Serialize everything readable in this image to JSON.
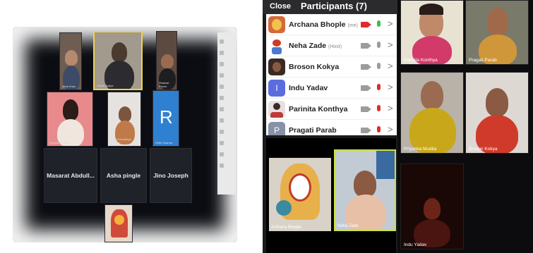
{
  "left_screen": {
    "tiles": [
      {
        "name": "Ishat Khan"
      },
      {
        "name": "Vishal Mojiya"
      },
      {
        "name": "Shaiwal Pravin"
      },
      {
        "name": "Suchita Natanai"
      },
      {
        "name": "Jyoti Holuradaya Chavan"
      },
      {
        "name": "Ridhi Sharma"
      },
      {
        "name": "Masarat Abdull..."
      },
      {
        "name": "Asha pingle"
      },
      {
        "name": "Jino Joseph"
      }
    ],
    "letter_tile": "R"
  },
  "participants_panel": {
    "close_label": "Close",
    "title": "Participants (7)",
    "rows": [
      {
        "name": "Archana Bhople",
        "tag": "(me)",
        "cam_color": "#e02b2b",
        "mic_color": "#3bbf4d",
        "chevron": ">"
      },
      {
        "name": "Neha Zade",
        "tag": "(Host)",
        "cam_color": "#9c9c9c",
        "mic_color": "#9c9c9c",
        "chevron": ">"
      },
      {
        "name": "Broson Kokya",
        "tag": "",
        "cam_color": "#9c9c9c",
        "mic_color": "#9c9c9c",
        "chevron": ">"
      },
      {
        "name": "Indu Yadav",
        "tag": "",
        "avatar_letter": "I",
        "cam_color": "#9c9c9c",
        "mic_color": "#e02b2b",
        "chevron": ">"
      },
      {
        "name": "Parinita Konthya",
        "tag": "",
        "cam_color": "#9c9c9c",
        "mic_color": "#e02b2b",
        "chevron": ">"
      },
      {
        "name": "Pragati Parab",
        "tag": "",
        "avatar_letter": "P",
        "cam_color": "#9c9c9c",
        "mic_color": "#e02b2b",
        "chevron": ">"
      }
    ],
    "videos": [
      {
        "name": "Archana Bhople"
      },
      {
        "name": "Neha Zade"
      }
    ]
  },
  "right_grid": {
    "videos": [
      {
        "name": "Parinita Konthya"
      },
      {
        "name": "Pragati Parab"
      },
      {
        "name": "Priyanka Mudila"
      },
      {
        "name": "Broson Kokya"
      },
      {
        "name": "Indu Yadav"
      }
    ]
  }
}
